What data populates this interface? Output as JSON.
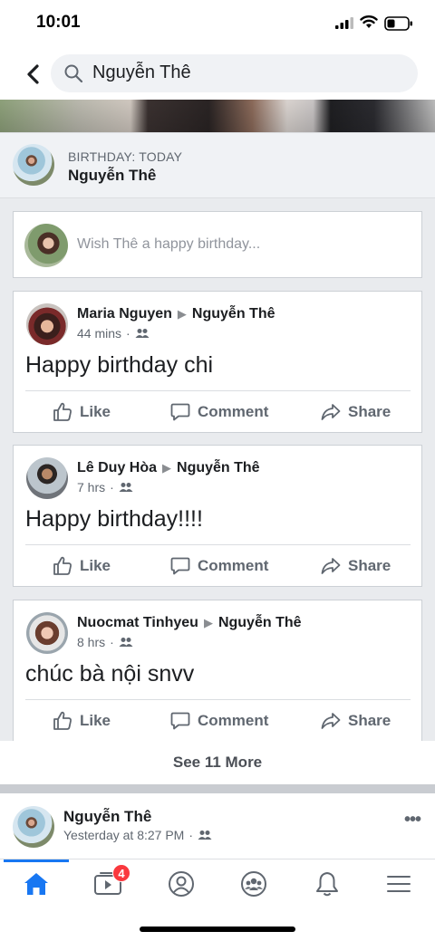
{
  "status_bar": {
    "time": "10:01"
  },
  "search": {
    "query": "Nguyễn Thê"
  },
  "birthday": {
    "label": "BIRTHDAY: TODAY",
    "name": "Nguyễn Thê"
  },
  "composer": {
    "placeholder": "Wish Thê a happy birthday..."
  },
  "posts": [
    {
      "author": "Maria Nguyen",
      "target": "Nguyễn Thê",
      "time": "44 mins",
      "text": "Happy birthday chi"
    },
    {
      "author": "Lê Duy Hòa",
      "target": "Nguyễn Thê",
      "time": "7 hrs",
      "text": "Happy birthday!!!!"
    },
    {
      "author": "Nuocmat Tinhyeu",
      "target": "Nguyễn Thê",
      "time": "8 hrs",
      "text": "chúc bà nội snvv"
    }
  ],
  "actions": {
    "like": "Like",
    "comment": "Comment",
    "share": "Share"
  },
  "see_more": "See 11 More",
  "feed_post": {
    "author": "Nguyễn Thê",
    "time": "Yesterday at 8:27 PM"
  },
  "tabs": {
    "watch_badge": "4",
    "items": [
      "home-icon",
      "watch-icon",
      "profile-icon",
      "groups-icon",
      "notifications-icon",
      "menu-icon"
    ]
  },
  "colors": {
    "accent": "#1877f2",
    "badge": "#fa383e",
    "muted": "#606770"
  }
}
